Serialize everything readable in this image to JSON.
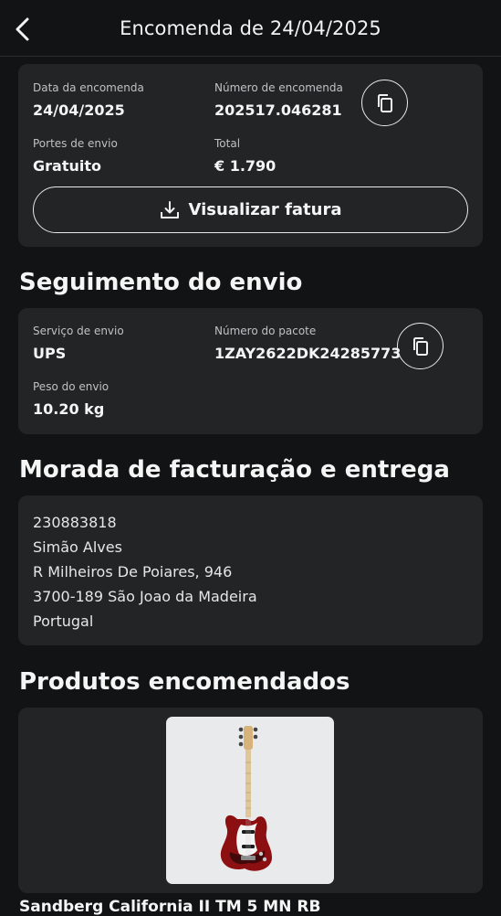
{
  "header": {
    "title": "Encomenda de 24/04/2025"
  },
  "order": {
    "date_label": "Data da encomenda",
    "date_value": "24/04/2025",
    "number_label": "Número de encomenda",
    "number_value": "202517.046281",
    "shipping_label": "Portes de envio",
    "shipping_value": "Gratuito",
    "total_label": "Total",
    "total_value": "€ 1.790",
    "invoice_button": "Visualizar fatura"
  },
  "tracking": {
    "section_title": "Seguimento do envio",
    "service_label": "Serviço de envio",
    "service_value": "UPS",
    "package_label": "Número do pacote",
    "package_value": "1ZAY2622DK24285773",
    "weight_label": "Peso do envio",
    "weight_value": "10.20 kg"
  },
  "address": {
    "section_title": "Morada de facturação e entrega",
    "lines": [
      "230883818",
      "Simão Alves",
      "R Milheiros De Poiares, 946",
      "3700-189 São Joao da Madeira",
      "Portugal"
    ]
  },
  "products": {
    "section_title": "Produtos encomendados",
    "items": [
      {
        "name": "Sandberg California II TM 5 MN RB"
      }
    ]
  },
  "icons": {
    "back": "chevron-left-icon",
    "copy": "copy-icon",
    "download": "download-icon"
  },
  "colors": {
    "background": "#121314",
    "card": "#222426",
    "text": "#f5f5f5",
    "muted": "#bfc1c3"
  }
}
